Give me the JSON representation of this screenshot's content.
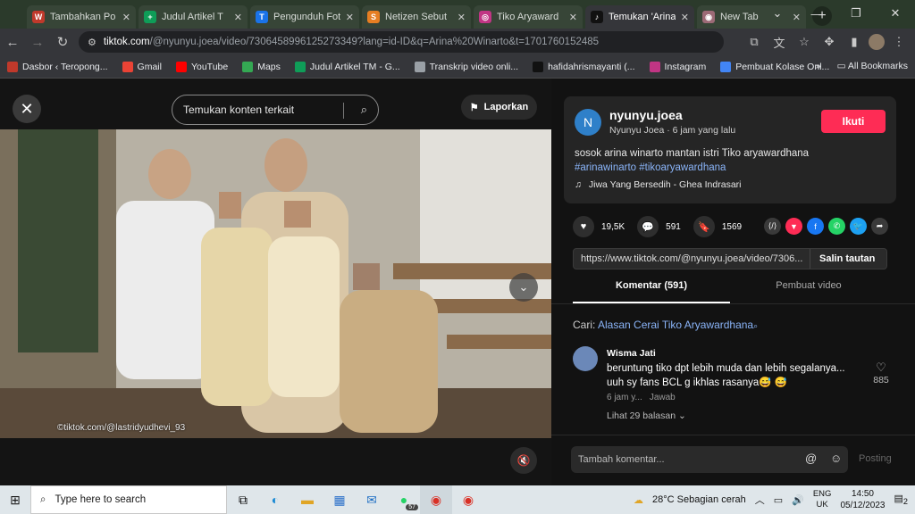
{
  "browser": {
    "tabs": [
      {
        "title": "Tambahkan Po",
        "color": "#c0392b",
        "glyph": "W",
        "active": false
      },
      {
        "title": "Judul Artikel T",
        "color": "#0f9d58",
        "glyph": "+",
        "active": false
      },
      {
        "title": "Pengunduh Fot",
        "color": "#1a73e8",
        "glyph": "T",
        "active": false
      },
      {
        "title": "Netizen Sebut",
        "color": "#e67e22",
        "glyph": "S",
        "active": false
      },
      {
        "title": "Tiko Aryaward",
        "color": "#c13584",
        "glyph": "◎",
        "active": false
      },
      {
        "title": "Temukan 'Arina",
        "color": "#111111",
        "glyph": "♪",
        "active": true
      },
      {
        "title": "New Tab",
        "color": "#9c6a76",
        "glyph": "◉",
        "active": false
      }
    ],
    "url_host": "tiktok.com",
    "url_path": "/@nyunyu.joea/video/7306458996125273349?lang=id-ID&q=Arina%20Winarto&t=1701760152485",
    "bookmarks": [
      {
        "label": "Dasbor ‹ Teropong...",
        "color": "#c0392b"
      },
      {
        "label": "Gmail",
        "color": "#ea4335"
      },
      {
        "label": "YouTube",
        "color": "#ff0000"
      },
      {
        "label": "Maps",
        "color": "#34a853"
      },
      {
        "label": "Judul Artikel TM - G...",
        "color": "#0f9d58"
      },
      {
        "label": "Transkrip video onli...",
        "color": "#9aa0a6"
      },
      {
        "label": "hafidahrismayanti (...",
        "color": "#111111"
      },
      {
        "label": "Instagram",
        "color": "#c13584"
      },
      {
        "label": "Pembuat Kolase Onl...",
        "color": "#4285f4"
      }
    ],
    "bookmarks_more": "»",
    "all_bookmarks": "All Bookmarks"
  },
  "video": {
    "search_placeholder": "Temukan konten terkait",
    "report_label": "Laporkan",
    "watermark": "©tiktok.com/@lastridyudhevi_93"
  },
  "author": {
    "avatar_letter": "N",
    "username": "nyunyu.joea",
    "display_meta": "Nyunyu Joea · 6 jam yang lalu",
    "follow_label": "Ikuti",
    "caption": "sosok arina winarto mantan istri Tiko aryawardhana",
    "hashtags": "#arinawinarto #tikoaryawardhana",
    "music": "Jiwa Yang Bersedih - Ghea Indrasari"
  },
  "stats": {
    "likes": "19,5K",
    "comments": "591",
    "saves": "1569"
  },
  "share": {
    "link": "https://www.tiktok.com/@nyunyu.joea/video/7306...",
    "copy_label": "Salin tautan",
    "colors": [
      "#3a3a3a",
      "#fe2c55",
      "#1877f2",
      "#25d366",
      "#1da1f2",
      "#3a3a3a"
    ]
  },
  "comments_section": {
    "tab_comments": "Komentar (591)",
    "tab_creator": "Pembuat video",
    "suggest_prefix": "Cari:",
    "suggest_query": "Alasan Cerai Tiko Aryawardhana",
    "items": [
      {
        "name": "Wisma Jati",
        "text": "beruntung tiko dpt lebih muda dan lebih segalanya... uuh sy fans BCL g ikhlas rasanya😅 😅",
        "time": "6 jam y...",
        "reply": "Jawab",
        "replies": "Lihat 29 balasan ⌄",
        "likes": "885"
      }
    ],
    "input_placeholder": "Tambah komentar...",
    "post_label": "Posting"
  },
  "taskbar": {
    "search_placeholder": "Type here to search",
    "whatsapp_badge": "57",
    "weather": "28°C  Sebagian cerah",
    "lang_1": "ENG",
    "lang_2": "UK",
    "time": "14:50",
    "date": "05/12/2023",
    "notif": "2"
  }
}
